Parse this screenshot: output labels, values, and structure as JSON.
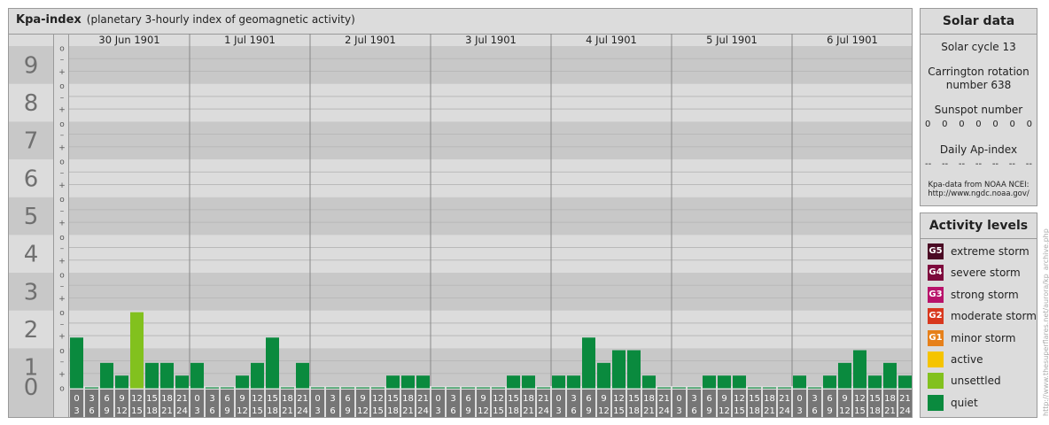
{
  "header": {
    "title": "Kpa-index",
    "subtitle": "(planetary 3-hourly index of geomagnetic activity)"
  },
  "chart_data": {
    "type": "bar",
    "title": "Kpa-index",
    "subtitle": "(planetary 3-hourly index of geomagnetic activity)",
    "ylim": [
      0,
      9
    ],
    "y_major_ticks": [
      "0",
      "1",
      "2",
      "3",
      "4",
      "5",
      "6",
      "7",
      "8",
      "9"
    ],
    "y_minor_labels": [
      "o",
      "+",
      "–"
    ],
    "days": [
      "30 Jun 1901",
      "1 Jul 1901",
      "2 Jul 1901",
      "3 Jul 1901",
      "4 Jul 1901",
      "5 Jul 1901",
      "6 Jul 1901"
    ],
    "interval_labels": [
      [
        "0",
        "3"
      ],
      [
        "3",
        "6"
      ],
      [
        "6",
        "9"
      ],
      [
        "9",
        "12"
      ],
      [
        "12",
        "15"
      ],
      [
        "15",
        "18"
      ],
      [
        "18",
        "21"
      ],
      [
        "21",
        "24"
      ]
    ],
    "values": [
      [
        1.333,
        0,
        0.667,
        0.333,
        2,
        0.667,
        0.667,
        0.333
      ],
      [
        0.667,
        0,
        0,
        0.333,
        0.667,
        1.333,
        0,
        0.667
      ],
      [
        0,
        0,
        0,
        0,
        0,
        0.333,
        0.333,
        0.333
      ],
      [
        0,
        0,
        0,
        0,
        0,
        0.333,
        0.333,
        0
      ],
      [
        0.333,
        0.333,
        1.333,
        0.667,
        1,
        1,
        0.333,
        0
      ],
      [
        0,
        0,
        0.333,
        0.333,
        0.333,
        0,
        0,
        0
      ],
      [
        0.333,
        0,
        0.333,
        0.667,
        1,
        0.333,
        0.667,
        0.333
      ]
    ],
    "level_colors": {
      "quiet": "#0a8a3e",
      "unsettled": "#82c11e"
    },
    "grid": true
  },
  "solar": {
    "heading": "Solar data",
    "cycle": "Solar cycle 13",
    "carrington_line1": "Carrington rotation",
    "carrington_line2": "number 638",
    "sunspot_label": "Sunspot number",
    "sunspot_values": [
      "0",
      "0",
      "0",
      "0",
      "0",
      "0",
      "0"
    ],
    "ap_label": "Daily Ap-index",
    "ap_values": [
      "--",
      "--",
      "--",
      "--",
      "--",
      "--",
      "--"
    ],
    "source_line1": "Kpa-data from NOAA NCEI:",
    "source_line2": "http://www.ngdc.noaa.gov/"
  },
  "activity": {
    "heading": "Activity levels",
    "levels": [
      {
        "badge": "G5",
        "label": "extreme storm",
        "color": "#4a0a24"
      },
      {
        "badge": "G4",
        "label": "severe storm",
        "color": "#7d0a3c"
      },
      {
        "badge": "G3",
        "label": "strong storm",
        "color": "#b8126a"
      },
      {
        "badge": "G2",
        "label": "moderate storm",
        "color": "#d8381e"
      },
      {
        "badge": "G1",
        "label": "minor storm",
        "color": "#e6801a"
      },
      {
        "badge": "",
        "label": "active",
        "color": "#f5c400"
      },
      {
        "badge": "",
        "label": "unsettled",
        "color": "#82c11e"
      },
      {
        "badge": "",
        "label": "quiet",
        "color": "#0a8a3e"
      }
    ]
  },
  "footer": {
    "side_credit": "http://www.thesuperflares.net/aurora/kp_archive.php"
  }
}
